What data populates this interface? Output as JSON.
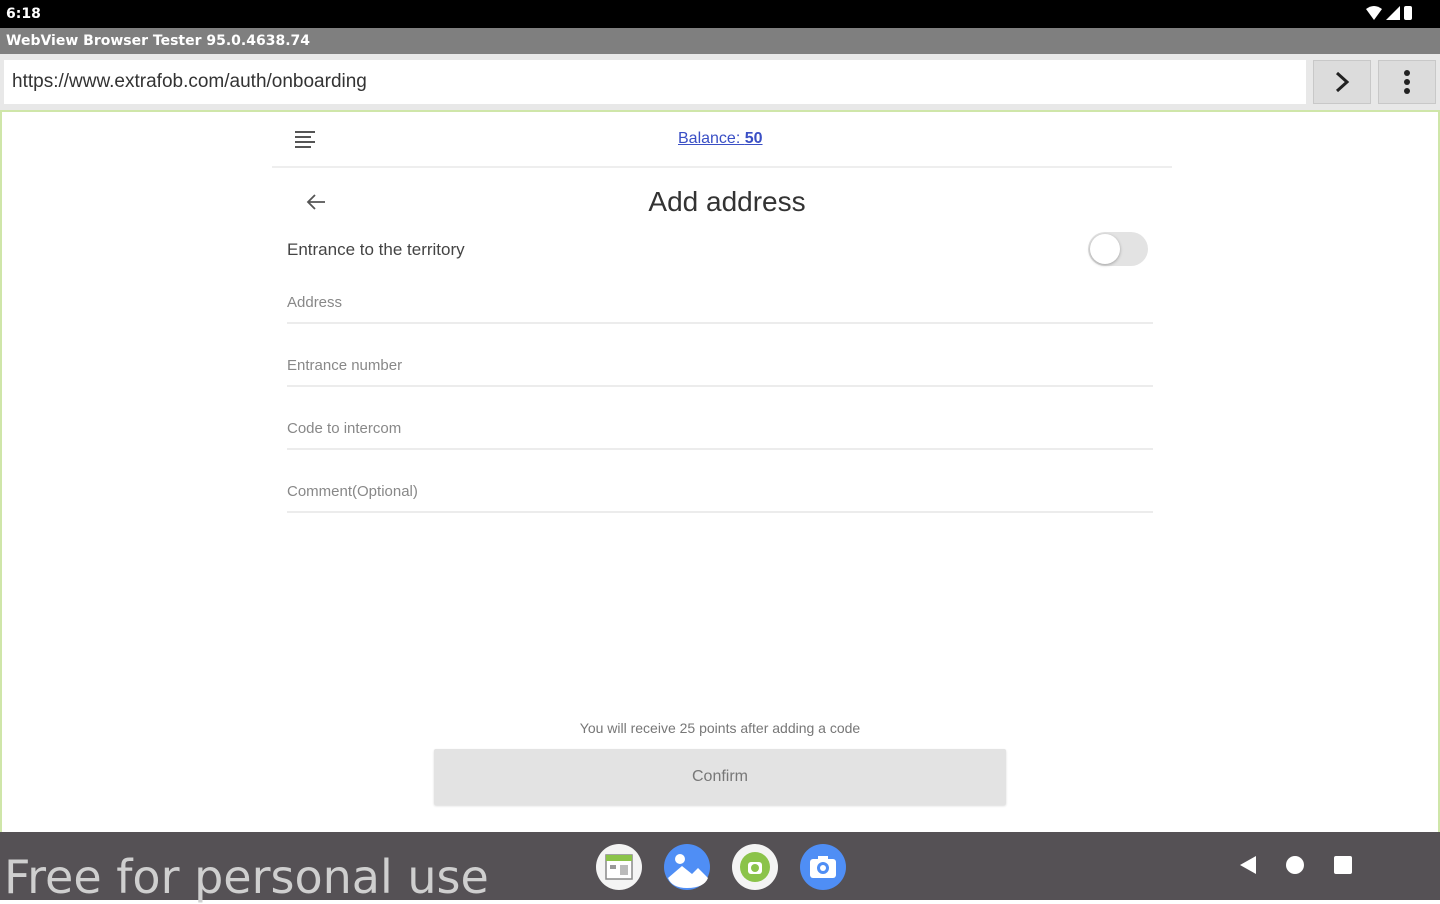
{
  "status_bar": {
    "time": "6:18"
  },
  "app": {
    "title": "WebView Browser Tester 95.0.4638.74"
  },
  "url_bar": {
    "url": "https://www.extrafob.com/auth/onboarding"
  },
  "header": {
    "balance_label": "Balance: ",
    "balance_value": "50"
  },
  "page": {
    "title": "Add address"
  },
  "toggle": {
    "label": "Entrance to the territory",
    "on": false
  },
  "fields": {
    "address": "Address",
    "entrance_number": "Entrance number",
    "intercom_code": "Code to intercom",
    "comment": "Comment(Optional)"
  },
  "hint": "You will receive 25 points after adding a code",
  "confirm_label": "Confirm",
  "watermark": "Free for personal use",
  "dock": [
    "calculator-app-icon",
    "gallery-app-icon",
    "android-app-icon",
    "camera-app-icon"
  ],
  "colors": {
    "link": "#3a4fc5",
    "content_border": "#cfe6a9",
    "nav_bg": "#555155"
  }
}
